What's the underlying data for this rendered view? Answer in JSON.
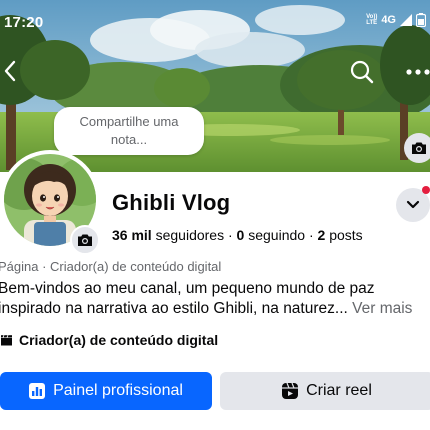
{
  "status": {
    "time": "17:20",
    "volte_top": "Vo))",
    "volte_bottom": "LTE",
    "network": "4G"
  },
  "note": {
    "placeholder_line1": "Compartilhe uma",
    "placeholder_line2": "nota..."
  },
  "profile": {
    "name": "Ghibli Vlog",
    "followers_count": "36 mil",
    "followers_label": "seguidores",
    "following_count": "0",
    "following_label": "seguindo",
    "posts_count": "2",
    "posts_label": "posts",
    "separator": "·",
    "category": "Página · Criador(a) de conteúdo digital",
    "bio_line1": "Bem-vindos ao meu canal, um pequeno mundo de paz",
    "bio_line2": "inspirado na narrativa ao estilo Ghibli, na naturez...",
    "see_more": "Ver mais",
    "creator_label": "Criador(a) de conteúdo digital"
  },
  "actions": {
    "primary_label": "Painel profissional",
    "secondary_label": "Criar reel"
  },
  "colors": {
    "primary_button": "#0866ff",
    "secondary_button": "#e4e6eb",
    "notification_dot": "#e41e3f",
    "muted_text": "#65676b"
  },
  "icons": [
    "back-arrow-icon",
    "search-icon",
    "more-icon",
    "camera-icon",
    "chevron-down-icon",
    "dashboard-icon",
    "reel-icon",
    "clapperboard-icon",
    "signal-icon",
    "battery-icon"
  ]
}
